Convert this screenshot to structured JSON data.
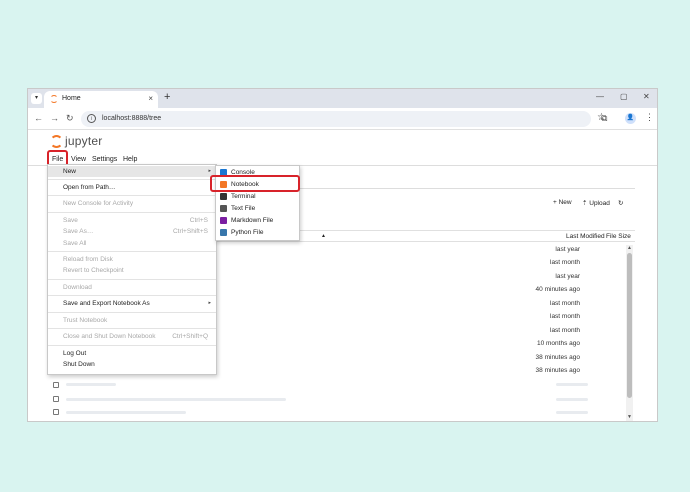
{
  "browser": {
    "tab_title": "Home",
    "tab_dropdown_glyph": "▾",
    "tab_close": "×",
    "tab_new": "+",
    "win_min": "—",
    "win_max": "▢",
    "win_close": "✕",
    "url": "localhost:8888/tree",
    "back": "←",
    "forward": "→",
    "reload": "↻",
    "info_glyph": "i",
    "star": "☆",
    "extensions": "⧉",
    "avatar": "👤",
    "kebab": "⋮"
  },
  "app": {
    "logo_text": "jupyter",
    "menu": [
      "File",
      "View",
      "Settings",
      "Help"
    ]
  },
  "filebrowser": {
    "new_label": "+ New",
    "upload_label": "⇡ Upload",
    "refresh_label": "↻",
    "sort_arrow": "▲",
    "col_modified": "Last Modified",
    "col_size": "File Size",
    "rows": [
      "last year",
      "last month",
      "last year",
      "40 minutes ago",
      "last month",
      "last month",
      "last month",
      "10 months ago",
      "38 minutes ago",
      "38 minutes ago"
    ],
    "scroll_up": "▲",
    "scroll_down": "▼"
  },
  "file_menu": {
    "new": "New",
    "open_from_path": "Open from Path…",
    "new_console": "New Console for Activity",
    "save": "Save",
    "save_sc": "Ctrl+S",
    "save_as": "Save As…",
    "save_as_sc": "Ctrl+Shift+S",
    "save_all": "Save All",
    "reload": "Reload from Disk",
    "revert": "Revert to Checkpoint",
    "download": "Download",
    "save_export": "Save and Export Notebook As",
    "trust": "Trust Notebook",
    "close_shutdown": "Close and Shut Down Notebook",
    "close_shutdown_sc": "Ctrl+Shift+Q",
    "logout": "Log Out",
    "shutdown": "Shut Down",
    "submenu_arrow": "▸"
  },
  "new_submenu": {
    "items": [
      "Console",
      "Notebook",
      "Terminal",
      "Text File",
      "Markdown File",
      "Python File"
    ],
    "colors": [
      "#1976d2",
      "#f37726",
      "#333333",
      "#555555",
      "#7b1fa2",
      "#3776ab"
    ]
  }
}
